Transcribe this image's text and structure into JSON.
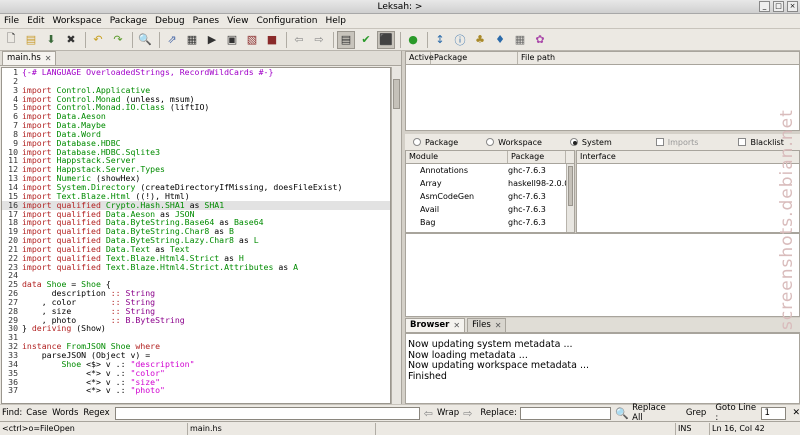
{
  "window": {
    "title": "Leksah: >"
  },
  "menu": [
    "File",
    "Edit",
    "Workspace",
    "Package",
    "Debug",
    "Panes",
    "View",
    "Configuration",
    "Help"
  ],
  "toolbar": {
    "icons": [
      "new-file-icon",
      "open-file-icon",
      "save-file-icon",
      "close-file-icon",
      "undo-icon",
      "redo-icon",
      "find-icon",
      "jump-icon",
      "build-icon",
      "run-icon",
      "package-icon",
      "clean-icon",
      "stop-icon",
      "back-icon",
      "forward-icon",
      "background-build-icon",
      "make-mode-icon",
      "debug-icon",
      "run-green-icon",
      "flip-icon",
      "info-icon",
      "sort-icon",
      "module-icon",
      "grid-icon",
      "color-icon"
    ]
  },
  "editor": {
    "tab": "main.hs",
    "current_line": 16,
    "lines": [
      [
        {
          "t": "{-# LANGUAGE OverloadedStrings, RecordWildCards #-}",
          "c": "pr"
        }
      ],
      [],
      [
        {
          "t": "import ",
          "c": "kw"
        },
        {
          "t": "Control.Applicative",
          "c": "mod"
        }
      ],
      [
        {
          "t": "import ",
          "c": "kw"
        },
        {
          "t": "Control.Monad",
          "c": "mod"
        },
        {
          "t": " (unless, msum)",
          "c": ""
        }
      ],
      [
        {
          "t": "import ",
          "c": "kw"
        },
        {
          "t": "Control.Monad.IO.Class",
          "c": "mod"
        },
        {
          "t": " (liftIO)",
          "c": ""
        }
      ],
      [
        {
          "t": "import ",
          "c": "kw"
        },
        {
          "t": "Data.Aeson",
          "c": "mod"
        }
      ],
      [
        {
          "t": "import ",
          "c": "kw"
        },
        {
          "t": "Data.Maybe",
          "c": "mod"
        }
      ],
      [
        {
          "t": "import ",
          "c": "kw"
        },
        {
          "t": "Data.Word",
          "c": "mod"
        }
      ],
      [
        {
          "t": "import ",
          "c": "kw"
        },
        {
          "t": "Database.HDBC",
          "c": "mod"
        }
      ],
      [
        {
          "t": "import ",
          "c": "kw"
        },
        {
          "t": "Database.HDBC.Sqlite3",
          "c": "mod"
        }
      ],
      [
        {
          "t": "import ",
          "c": "kw"
        },
        {
          "t": "Happstack.Server",
          "c": "mod"
        }
      ],
      [
        {
          "t": "import ",
          "c": "kw"
        },
        {
          "t": "Happstack.Server.Types",
          "c": "mod"
        }
      ],
      [
        {
          "t": "import ",
          "c": "kw"
        },
        {
          "t": "Numeric",
          "c": "mod"
        },
        {
          "t": " (showHex)",
          "c": ""
        }
      ],
      [
        {
          "t": "import ",
          "c": "kw"
        },
        {
          "t": "System.Directory",
          "c": "mod"
        },
        {
          "t": " (createDirectoryIfMissing, doesFileExist)",
          "c": ""
        }
      ],
      [
        {
          "t": "import ",
          "c": "kw"
        },
        {
          "t": "Text.Blaze.Html",
          "c": "mod"
        },
        {
          "t": " ((!), Html)",
          "c": ""
        }
      ],
      [
        {
          "t": "import ",
          "c": "kw"
        },
        {
          "t": "qualified ",
          "c": "kw"
        },
        {
          "t": "Crypto.Hash.SHA1",
          "c": "mod"
        },
        {
          "t": " as ",
          "c": ""
        },
        {
          "t": "SHA1",
          "c": "mod"
        }
      ],
      [
        {
          "t": "import ",
          "c": "kw"
        },
        {
          "t": "qualified ",
          "c": "kw"
        },
        {
          "t": "Data.Aeson",
          "c": "mod"
        },
        {
          "t": " as ",
          "c": ""
        },
        {
          "t": "JSON",
          "c": "mod"
        }
      ],
      [
        {
          "t": "import ",
          "c": "kw"
        },
        {
          "t": "qualified ",
          "c": "kw"
        },
        {
          "t": "Data.ByteString.Base64",
          "c": "mod"
        },
        {
          "t": " as ",
          "c": ""
        },
        {
          "t": "Base64",
          "c": "mod"
        }
      ],
      [
        {
          "t": "import ",
          "c": "kw"
        },
        {
          "t": "qualified ",
          "c": "kw"
        },
        {
          "t": "Data.ByteString.Char8",
          "c": "mod"
        },
        {
          "t": " as ",
          "c": ""
        },
        {
          "t": "B",
          "c": "mod"
        }
      ],
      [
        {
          "t": "import ",
          "c": "kw"
        },
        {
          "t": "qualified ",
          "c": "kw"
        },
        {
          "t": "Data.ByteString.Lazy.Char8",
          "c": "mod"
        },
        {
          "t": " as ",
          "c": ""
        },
        {
          "t": "L",
          "c": "mod"
        }
      ],
      [
        {
          "t": "import ",
          "c": "kw"
        },
        {
          "t": "qualified ",
          "c": "kw"
        },
        {
          "t": "Data.Text",
          "c": "mod"
        },
        {
          "t": " as ",
          "c": ""
        },
        {
          "t": "Text",
          "c": "mod"
        }
      ],
      [
        {
          "t": "import ",
          "c": "kw"
        },
        {
          "t": "qualified ",
          "c": "kw"
        },
        {
          "t": "Text.Blaze.Html4.Strict",
          "c": "mod"
        },
        {
          "t": " as ",
          "c": ""
        },
        {
          "t": "H",
          "c": "mod"
        }
      ],
      [
        {
          "t": "import ",
          "c": "kw"
        },
        {
          "t": "qualified ",
          "c": "kw"
        },
        {
          "t": "Text.Blaze.Html4.Strict.Attributes",
          "c": "mod"
        },
        {
          "t": " as ",
          "c": ""
        },
        {
          "t": "A",
          "c": "mod"
        }
      ],
      [],
      [
        {
          "t": "data ",
          "c": "kw"
        },
        {
          "t": "Shoe",
          "c": "mod"
        },
        {
          "t": " = ",
          "c": ""
        },
        {
          "t": "Shoe",
          "c": "mod"
        },
        {
          "t": " {",
          "c": ""
        }
      ],
      [
        {
          "t": "      description ",
          "c": ""
        },
        {
          "t": ":: ",
          "c": "kw"
        },
        {
          "t": "String",
          "c": "ty"
        }
      ],
      [
        {
          "t": "    , color       ",
          "c": ""
        },
        {
          "t": ":: ",
          "c": "kw"
        },
        {
          "t": "String",
          "c": "ty"
        }
      ],
      [
        {
          "t": "    , size        ",
          "c": ""
        },
        {
          "t": ":: ",
          "c": "kw"
        },
        {
          "t": "String",
          "c": "ty"
        }
      ],
      [
        {
          "t": "    , photo       ",
          "c": ""
        },
        {
          "t": ":: ",
          "c": "kw"
        },
        {
          "t": "B.ByteString",
          "c": "ty"
        }
      ],
      [
        {
          "t": "} ",
          "c": ""
        },
        {
          "t": "deriving ",
          "c": "kw"
        },
        {
          "t": "(Show)",
          "c": ""
        }
      ],
      [],
      [
        {
          "t": "instance ",
          "c": "kw"
        },
        {
          "t": "FromJSON Shoe ",
          "c": "mod"
        },
        {
          "t": "where",
          "c": "kw"
        }
      ],
      [
        {
          "t": "    parseJSON (Object v) =",
          "c": ""
        }
      ],
      [
        {
          "t": "        ",
          "c": ""
        },
        {
          "t": "Shoe",
          "c": "mod"
        },
        {
          "t": " <$> v .: ",
          "c": ""
        },
        {
          "t": "\"description\"",
          "c": "str"
        }
      ],
      [
        {
          "t": "             <*> v .: ",
          "c": ""
        },
        {
          "t": "\"color\"",
          "c": "str"
        }
      ],
      [
        {
          "t": "             <*> v .: ",
          "c": ""
        },
        {
          "t": "\"size\"",
          "c": "str"
        }
      ],
      [
        {
          "t": "             <*> v .: ",
          "c": ""
        },
        {
          "t": "\"photo\"",
          "c": "str"
        }
      ]
    ]
  },
  "workspace_header": {
    "active": "Active",
    "package": "Package",
    "filepath": "File path"
  },
  "scope": {
    "package": "Package",
    "workspace": "Workspace",
    "system": "System",
    "imports": "Imports",
    "blacklist": "Blacklist",
    "selected": "system"
  },
  "modules": {
    "header_module": "Module",
    "header_package": "Package",
    "header_interface": "Interface",
    "rows": [
      {
        "module": "Annotations",
        "package": "ghc-7.6.3"
      },
      {
        "module": "Array",
        "package": "haskell98-2.0.0"
      },
      {
        "module": "AsmCodeGen",
        "package": "ghc-7.6.3"
      },
      {
        "module": "Avail",
        "package": "ghc-7.6.3"
      },
      {
        "module": "Bag",
        "package": "ghc-7.6.3"
      }
    ]
  },
  "bottom_tabs": [
    "Browser",
    "Files"
  ],
  "log": [
    "Now updating system metadata ...",
    "Now loading metadata ...",
    "Now updating workspace metadata ...",
    "Finished"
  ],
  "findbar": {
    "find": "Find:",
    "case": "Case",
    "words": "Words",
    "regex": "Regex",
    "wrap": "Wrap",
    "replace_label": "Replace:",
    "replace_all": "Replace All",
    "grep": "Grep",
    "goto": "Goto Line :",
    "goto_value": "1"
  },
  "status": {
    "keys": "<ctrl>o=FileOpen",
    "file": "main.hs",
    "mode": "INS",
    "position": "Ln  16, Col  42"
  },
  "watermark": "screenshots.debian.net"
}
